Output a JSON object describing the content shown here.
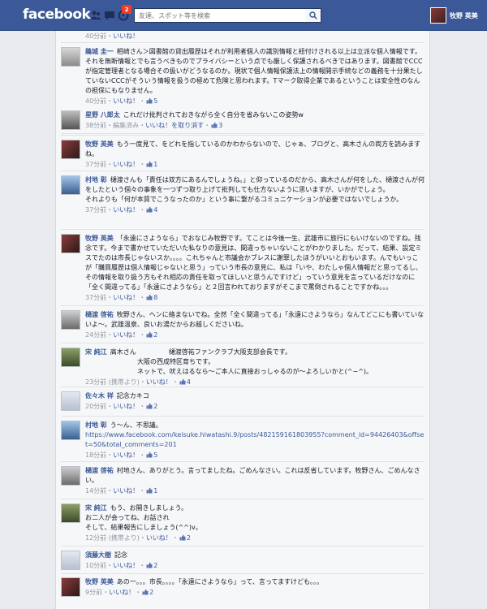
{
  "topbar": {
    "logo": "facebook",
    "notifications_count": "2",
    "search_placeholder": "友達、スポット等を検索",
    "user_name": "牧野 英美"
  },
  "comments": [
    {
      "author": "",
      "text": "",
      "time": "40分前",
      "like": "いいね！",
      "likes": ""
    },
    {
      "author": "鵜城 圭一",
      "text": "相崎さん＞図書館の貸出履歴はそれが利用者個人の識別情報と紐付けされる以上は立派な個人情報です。それを無断情報とでも言うべきものでプライバシーという点でも厳しく保護されるべきではあります。図書館でCCCが指定管理者となる場合その扱いがどうなるのか。現状で個人情報保護法上の情報開示手続などの義務を十分果たしていないCCCがそういう情報を扱うの極めて危険と思われます。Tマーク取得企業であるということは安全性のなんの担保にもなりません。",
      "time": "40分前",
      "like": "いいね！",
      "likes": "5"
    },
    {
      "author": "星野 八郎太",
      "text": "これだけ批判されておきながら全く自分を省みないこの姿勢w",
      "time": "38分前・編集済み",
      "like": "いいね！を取り消す",
      "likes": "3"
    },
    {
      "author": "牧野 英美",
      "text": "もう一度見て、をどれを指しているのかわからないので、じゃぁ、ブログと、高木さんの両方を読みますね。",
      "time": "37分前",
      "like": "いいね！",
      "likes": "1"
    },
    {
      "author": "村地 彰",
      "text": "樋渡さんも「責任は双方にあるんでしょうね。」と仰っているのだから、高木さんが何をした、樋渡さんが何をしたという個々の事象を一つずつ取り上げて批判しても仕方ないように思いますが、いかがでしょう。\nそれよりも「何が本質でこうなったのか」という事に繋がるコミュニケーションが必要ではないでしょうか。",
      "time": "37分前",
      "like": "いいね！",
      "likes": "4"
    },
    {
      "author": "牧野 英美",
      "text": "「永遠にさようなら」でおなじみ牧野です。てことは今後一生、武雄市に旅行にもいけないのですね。残念です。今まで書かせていただいた私なりの意見は、間違っちゃいないことがわかりました。だって、結果、設定ミスでたのは市長じゃないスか。。。。これちゃんと市議会かブレスに謝罪したほうがいいとおもいます。んでもいっこが「購買履歴は個人情報じゃないと思う」っていう市長の意見に、私は「いや、わたしゃ個人情報だと思ってるし、その情報を取り扱う方もそれ相応の責任を取ってほしいと思うんですけど」っていう意見を言っているだけなのに「全く間違ってる」「永遠にさようなら」と２回言われておりますがそこまで罵倒されることですかね。。。",
      "time": "37分前",
      "like": "いいね！",
      "likes": "8"
    },
    {
      "author": "樋渡 啓祐",
      "text": "牧野さん、ヘンに絡まないでね。全然「全く間違ってる」「永遠にさようなら」なんてどこにも書いていないよ〜。武雄温泉、良いお湯だからお越しくださいね。",
      "time": "24分前",
      "like": "いいね！",
      "likes": "2"
    },
    {
      "author": "宋 純江",
      "text": "高木さん　　　　　樋渡啓祐ファンクラブ大阪支部会長です。\n　　　　　　　　大阪の西成特区育ちです。\n　　　　　　　　ネットで、吠えはるなら〜ご本人に直接おっしゃるのが〜よろしいかと(^−^)。",
      "time": "23分前 (携帯より)",
      "like": "いいね！",
      "likes": "4"
    },
    {
      "author": "佐々木 祥",
      "text": "記念カキコ",
      "time": "20分前",
      "like": "いいね！",
      "likes": "2"
    },
    {
      "author": "村地 彰",
      "text": "う〜ん、不思議。",
      "url": "https://www.facebook.com/keisuke.hiwatashi.9/posts/482159161803955?comment_id=94426403&offset=50&total_comments=201",
      "time": "18分前",
      "like": "いいね！",
      "likes": "5"
    },
    {
      "author": "樋渡 啓祐",
      "text": "村地さん、ありがとう。言ってましたね。ごめんなさい。これは反省しています。牧野さん、ごめんなさい。",
      "time": "14分前",
      "like": "いいね！",
      "likes": "1"
    },
    {
      "author": "宋 純江",
      "text": "もう、お開きしましょう。\nお二人が会ってね、お話され\nそして、結果報告にしましょう(^^)v。",
      "time": "12分前 (携帯より)",
      "like": "いいね！",
      "likes": "2"
    },
    {
      "author": "須藤大樹",
      "text": "記念",
      "time": "10分前",
      "like": "いいね！",
      "likes": "2"
    },
    {
      "author": "牧野 英美",
      "text": "あの一。。。市長。。。。「永遠にさようなら」って、言ってますけども。。。",
      "time": "9分前",
      "like": "いいね！",
      "likes": "2"
    }
  ]
}
